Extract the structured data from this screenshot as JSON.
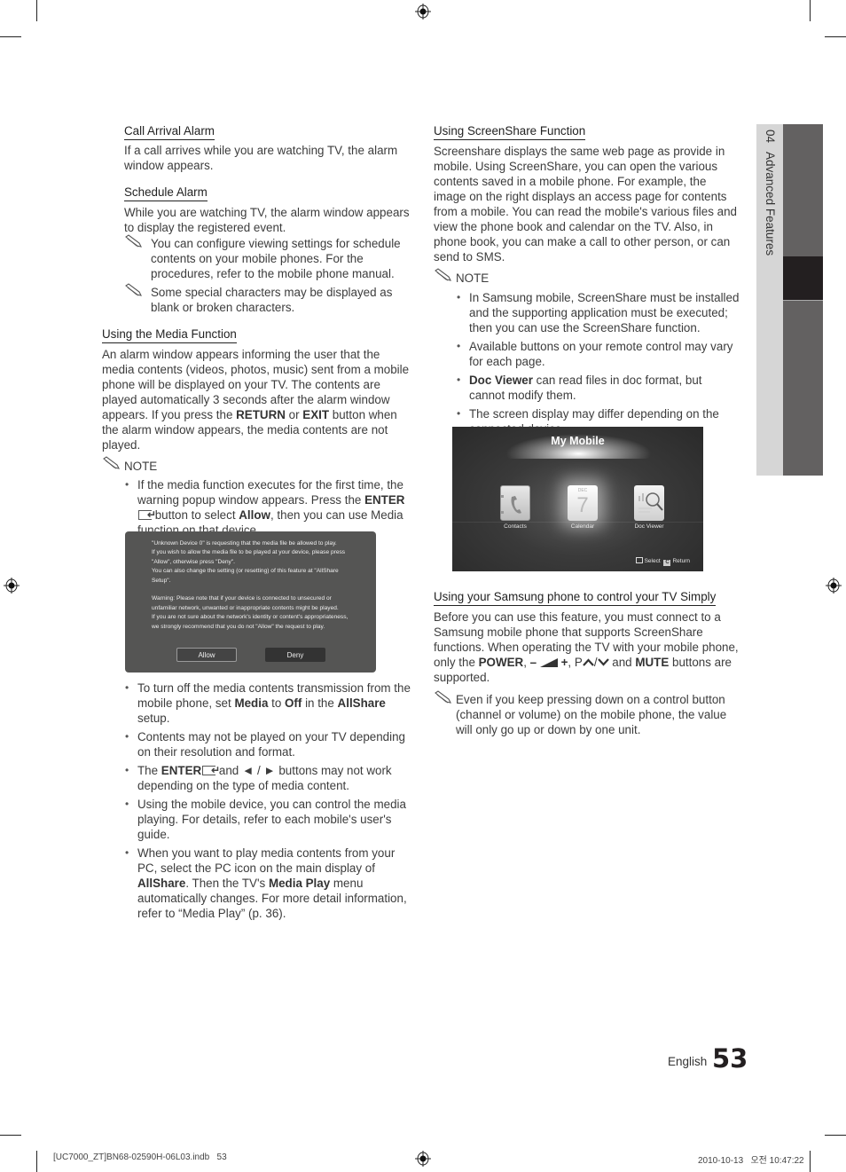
{
  "left_column": {
    "call_arrival": {
      "heading": "Call Arrival Alarm",
      "body": "If a call arrives while you are watching TV, the alarm window appears."
    },
    "schedule": {
      "heading": "Schedule Alarm",
      "body": "While you are watching TV, the alarm window appears to display the registered event.",
      "notes": [
        "You can configure viewing settings for schedule contents on your mobile phones. For the procedures, refer to the mobile phone manual.",
        "Some special characters may be displayed as blank or broken characters."
      ]
    },
    "media": {
      "heading": "Using the Media Function",
      "body_1": "An alarm window appears informing the user that the media contents (videos, photos, music) sent from a mobile phone will be displayed on your TV. The contents are played automatically 3 seconds after the alarm window appears.",
      "body_2_pre": "If you press the ",
      "body_2_b1": "RETURN",
      "body_2_mid": " or ",
      "body_2_b2": "EXIT",
      "body_2_post": " button when the alarm window appears, the media contents are not played.",
      "note_label": "NOTE",
      "bullet1": {
        "pre": "If the media function executes for the first time, the warning popup window appears. Press the ",
        "b1": "ENTER",
        "mid": " button to select ",
        "b2": "Allow",
        "post": ", then you can use Media function on that device."
      },
      "dialog": {
        "line1": "\"Unknown Device 0\" is requesting that the media file be allowed to play.",
        "line2": "If you wish to allow the media file to be played at your device, please press",
        "line3": "\"Allow\", otherwise press \"Deny\".",
        "line4": "You can also change the setting (or resetting) of this feature at \"AllShare",
        "line5": "Setup\".",
        "line6": "Warning: Please note that if your device is connected to unsecured or",
        "line7": "unfamiliar network, unwanted or inappropriate contents might be played.",
        "line8": "If you are not sure about the network's identity or content's appropriateness,",
        "line9": "we strongly recommend that you do not \"Allow\" the request to play.",
        "allow_label": "Allow",
        "deny_label": "Deny"
      },
      "bullet2": {
        "pre": "To turn off the media contents transmission from the mobile phone, set ",
        "b1": "Media",
        "mid1": " to ",
        "b2": "Off",
        "mid2": " in the ",
        "b3": "AllShare",
        "post": " setup."
      },
      "bullet3": "Contents may not be played on your TV depending on their resolution and format.",
      "bullet4": {
        "pre": "The ",
        "b1": "ENTER",
        "post": " and ◄ / ► buttons may not work depending on the type of media content."
      },
      "bullet5": "Using the mobile device, you can control the media playing. For details, refer to each mobile's user's guide.",
      "bullet6": {
        "pre": "When you want to play media contents from your PC, select the PC icon on the main display of ",
        "b1": "AllShare",
        "mid": ". Then the TV's ",
        "b2": "Media Play",
        "post": " menu automatically changes. For more detail information, refer to “Media Play” (p. 36)."
      }
    }
  },
  "right_column": {
    "screenshare": {
      "heading": "Using ScreenShare Function",
      "body": "Screenshare displays the same web page as provide in mobile. Using ScreenShare, you can open the various contents saved in a mobile phone. For example, the image on the right displays an access page for contents from a mobile. You can read the mobile's various files and view the phone book and calendar on the TV. Also, in phone book, you can make a call to other person, or can send to SMS.",
      "note_label": "NOTE",
      "bullet1": "In Samsung mobile, ScreenShare must be installed and the supporting application must be executed; then you can use the ScreenShare function.",
      "bullet2": "Available buttons on your remote control may vary for each page.",
      "bullet3_b": "Doc Viewer",
      "bullet3_post": " can read files in doc format, but cannot modify them.",
      "bullet4": "The screen display may differ depending on the connected device."
    },
    "my_mobile": {
      "title": "My Mobile",
      "items": [
        {
          "label": "Contacts",
          "icon": "contacts-icon"
        },
        {
          "label": "Calendar",
          "icon": "calendar-icon",
          "month": "DEC",
          "day": "7"
        },
        {
          "label": "Doc Viewer",
          "icon": "doc-viewer-icon"
        }
      ],
      "select_label": "Select",
      "return_key": "C",
      "return_label": "Return"
    },
    "samsung_phone": {
      "heading": "Using your Samsung phone to control your TV Simply",
      "body_pre": "Before you can use this feature, you must connect to a Samsung mobile phone that supports ScreenShare functions. When operating the TV with your mobile phone, only the ",
      "b_power": "POWER",
      "vol_minus": "–",
      "vol_plus": "+",
      "ch_prefix": "P",
      "b_mute": "MUTE",
      "body_post": " buttons are supported.",
      "and_text": " and ",
      "note": "Even if you keep pressing down on a control button (channel or volume) on the mobile phone, the value will only go up or down by one unit."
    }
  },
  "side_tab": {
    "chapter_num": "04",
    "chapter_title": "Advanced Features"
  },
  "page": {
    "language": "English",
    "number": "53"
  },
  "footer": {
    "file": "[UC7000_ZT]BN68-02590H-06L03.indb   53",
    "timestamp": "2010-10-13   오전 10:47:22"
  }
}
